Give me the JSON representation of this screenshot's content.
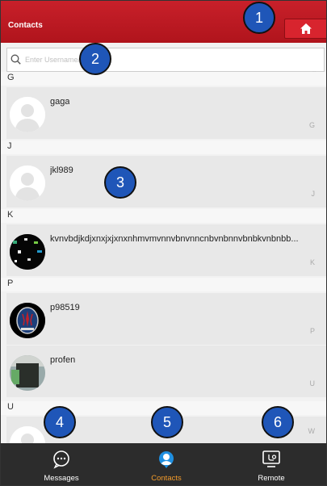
{
  "header": {
    "title": "Contacts",
    "home_icon": "home-icon"
  },
  "search": {
    "placeholder": "Enter Username/Name/SN",
    "value": ""
  },
  "index_hash": "#",
  "sections": [
    {
      "letter": "G",
      "contacts": [
        {
          "name": "gaga",
          "index": "G",
          "avatar": "default-avatar"
        }
      ]
    },
    {
      "letter": "J",
      "contacts": [
        {
          "name": "jkl989",
          "index": "J",
          "avatar": "default-avatar"
        }
      ]
    },
    {
      "letter": "K",
      "contacts": [
        {
          "name": "kvnvbdjkdjxnxjxjxnxnhmvmvnnvbnvnncnbvnbnnvbnbkvnbnbb...",
          "index": "K",
          "avatar": "photo-dark-screen"
        }
      ]
    },
    {
      "letter": "P",
      "contacts": [
        {
          "name": "p98519",
          "index": "P",
          "avatar": "maserati-logo"
        },
        {
          "name": "profen",
          "index": "U",
          "avatar": "photo-device"
        }
      ]
    },
    {
      "letter": "U",
      "contacts": [
        {
          "name": "",
          "index": "W",
          "avatar": "default-avatar"
        }
      ]
    }
  ],
  "callouts": [
    "1",
    "2",
    "3",
    "4",
    "5",
    "6"
  ],
  "bottom_nav": [
    {
      "label": "Messages",
      "icon": "chat-bubble-icon",
      "active": false
    },
    {
      "label": "Contacts",
      "icon": "person-icon",
      "active": true
    },
    {
      "label": "Remote",
      "icon": "remote-screen-icon",
      "active": false
    }
  ],
  "colors": {
    "header": "#c8202a",
    "active_nav": "#f39b2a",
    "nav_bg": "#2c2c2c",
    "callout": "#1f56b8"
  }
}
